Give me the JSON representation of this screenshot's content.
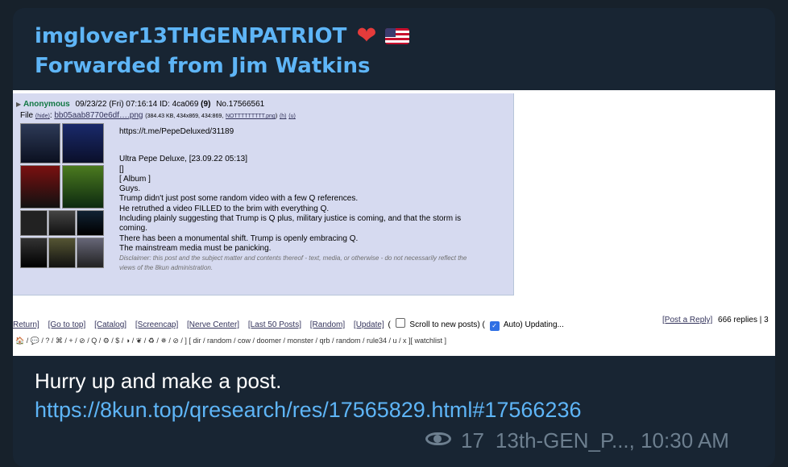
{
  "sender": {
    "name": "imglover13THGENPATRIOT",
    "heart_emoji": "❤️",
    "flag_emoji": "🇺🇸"
  },
  "forwarded": "Forwarded from Jim Watkins",
  "screenshot": {
    "intro": {
      "arrow": "▶",
      "name": "Anonymous",
      "datetime": "09/23/22 (Fri) 07:16:14",
      "id_label": "ID:",
      "id": "4ca069",
      "id_count": "(9)",
      "post_no": "No.17566561"
    },
    "file": {
      "label": "File",
      "hide": "(hide)",
      "filename": "bb05aab8770e6df….png",
      "meta": "(384.43 KB, 434x869, 434:869,",
      "orig": "NOTTTTTTTTT.png",
      "tail": ")",
      "h": "(h)",
      "u": "(u)"
    },
    "body": {
      "link": "https://t.me/PepeDeluxed/31189",
      "line1": "Ultra Pepe Deluxe, [23.09.22 05:13]",
      "line2": "[]",
      "line3": "[ Album ]",
      "line4": "Guys.",
      "line5": "Trump didn't just post some random video with a few Q references.",
      "line6": "He retruthed a video FILLED to the brim with everything Q.",
      "line7": "Including plainly suggesting that Trump is Q plus, military justice is coming, and that the storm is",
      "line8": "coming.",
      "line9": "There has been a monumental shift. Trump is openly embracing Q.",
      "line10": "The mainstream media must be panicking.",
      "disclaimer1": "Disclaimer: this post and the subject matter and contents thereof - text, media, or otherwise - do not necessarily reflect the",
      "disclaimer2": "views of the 8kun administration."
    },
    "nav": {
      "return": "Return]",
      "top": "[Go to top]",
      "catalog": "[Catalog]",
      "screencap": "[Screencap]",
      "nerve": "[Nerve Center]",
      "last50": "[Last 50 Posts]",
      "random": "[Random]",
      "update": "[Update]",
      "paren_open": "(",
      "scroll_label": "Scroll to new posts) (",
      "auto_label": "Auto) Updating...",
      "reply": "[Post a Reply]",
      "replies": "666 replies | 3"
    },
    "boardbar": "🏠 / 💬 / ? / ⌘ / + / ⊘ / Q / ⚙ / $ / ◑ / ❦ / ♻ / ✵ / ⊘ / ] [ dir / random / cow / doomer / monster / qrb / random / rule34 / u / x ][ watchlist ]"
  },
  "message": {
    "text": "Hurry up and make a post.",
    "link": "https://8kun.top/qresearch/res/17565829.html#17566236"
  },
  "meta": {
    "views": "17",
    "author_time": "13th-GEN_P..., 10:30 AM"
  }
}
